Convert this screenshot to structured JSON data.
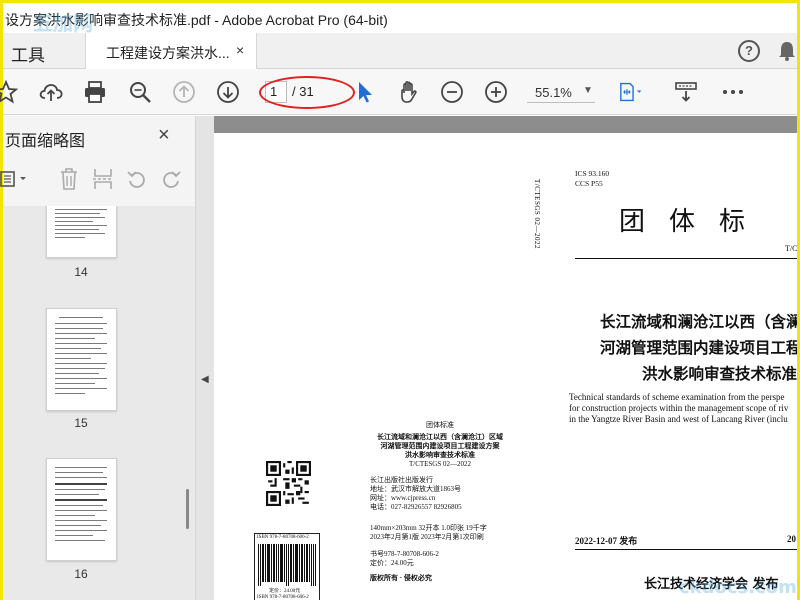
{
  "window": {
    "title": "设方案洪水影响审查技术标准.pdf - Adobe Acrobat Pro (64-bit)"
  },
  "tabs": {
    "tools_label": "工具",
    "doc_tab_label": "工程建设方案洪水...",
    "doc_tab_close": "×",
    "help_label": "?"
  },
  "toolbar": {
    "current_page": "1",
    "total_pages": "/ 31",
    "zoom": "55.1%",
    "icons": [
      "star-icon",
      "upload-icon",
      "print-icon",
      "zoom-search-icon",
      "page-up-icon",
      "page-down-icon",
      "select-cursor-icon",
      "hand-icon",
      "zoom-out-icon",
      "zoom-in-icon",
      "fit-page-icon",
      "scroll-mode-icon",
      "more-icon"
    ]
  },
  "sidebar": {
    "title": "页面缩略图",
    "close": "×",
    "thumbnails": [
      {
        "page": "14"
      },
      {
        "page": "15"
      },
      {
        "page": "16"
      }
    ]
  },
  "document": {
    "vertical_code": "T/CTESGS 02—2022",
    "back_cover": {
      "std_label": "团体标准",
      "title_1": "长江流域和澜沧江以西（含澜沧江）区域",
      "title_2": "河湖管理范围内建设项目工程建设方案",
      "title_3": "洪水影响审查技术标准",
      "code": "T/CTESGS 02—2022",
      "pub_1": "长江出版社出版发行",
      "pub_2": "地址：武汉市解放大道1863号",
      "pub_3": "网址：www.cjpress.cn",
      "pub_4": "电话：027-82926557   82926805",
      "spec_1": "140mm×203mm  32开本    1.0印张    19千字",
      "spec_2": "2023年2月第1版              2023年2月第1次印刷",
      "isbn_line": "书号978-7-80708-606-2",
      "price_line": "定价：24.00元",
      "rights": "版权所有 · 侵权必究"
    },
    "barcode": {
      "isbn_top": "ISBN 978-7-80708-606-2",
      "price": "定价：24.00元",
      "isbn_bottom": "ISBN 978-7-80708-606-2"
    },
    "front_cover": {
      "ics": "ICS 93.160",
      "ccs": "CCS P55",
      "std_type": "团体标",
      "tc_code": "T/C",
      "title_1": "长江流域和澜沧江以西（含澜沧",
      "title_2": "河湖管理范围内建设项目工程建",
      "title_3": "洪水影响审查技术标准",
      "en_1": "Technical standards of scheme examination from the perspe",
      "en_2": "for construction projects within the management scope of riv",
      "en_3": "in the Yangtze River Basin and west of  Lancang River (inclu",
      "issue_date": "2022-12-07 发布",
      "impl_date": "20",
      "publisher": "长江技术经济学会    发布"
    }
  },
  "watermarks": {
    "top_left": "五加网",
    "bottom_right": "ckdocs.com"
  },
  "colors": {
    "frame": "#f2e600",
    "annotation": "#e02020",
    "select_cursor": "#1f6fd6"
  }
}
